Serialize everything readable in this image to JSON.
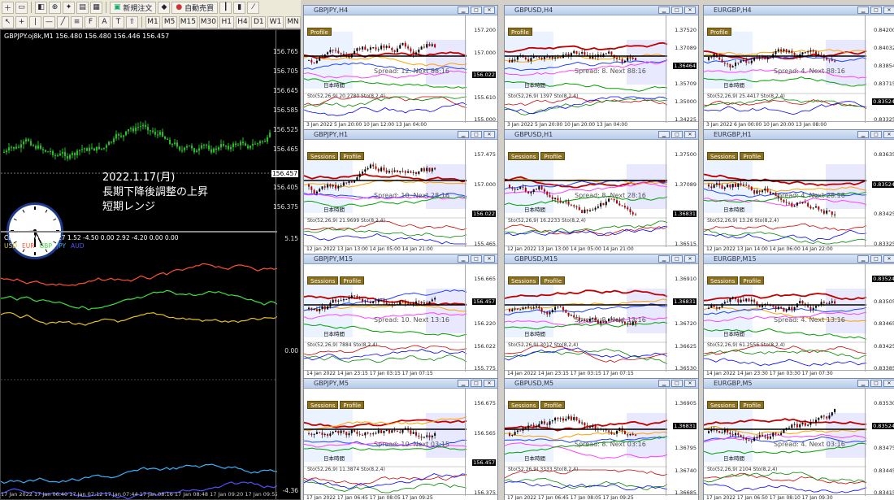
{
  "toolbar": {
    "new_order": "新規注文",
    "auto_trading": "自動売買",
    "timeframes": [
      "M1",
      "M5",
      "M15",
      "M30",
      "H1",
      "H4",
      "D1",
      "W1",
      "MN"
    ]
  },
  "main_chart": {
    "title": "GBPJPY.oj8k,M1  156.480 156.480 156.446 156.457",
    "price_ticks": [
      "156.765",
      "156.705",
      "156.645",
      "156.585",
      "156.525",
      "156.465",
      "156.457",
      "156.405",
      "156.375"
    ],
    "current_price": "156.457",
    "annotation_lines": [
      "2022.1.17(月)",
      "長期下降後調整の上昇",
      "短期レンジ"
    ],
    "indicator_title": "CurrencyPower 4.27 1.52 -4.50 0.00 2.92 -4.20 0.00 0.00",
    "legend": [
      "USD",
      "EUR",
      "GBP",
      "JPY",
      "AUD"
    ],
    "indicator_ticks": [
      "5.15",
      "0.00",
      "-4.36"
    ],
    "time_axis": "17 Jan 2022  17 Jan 06:40  17 Jan 07:12  17 Jan 07:44  17 Jan 08:16  17 Jan 08:48  17 Jan 09:20  17 Jan 09:52  17 Jan 10:24"
  },
  "colors": {
    "usd": "#e8c020",
    "eur": "#ff5030",
    "gbp": "#40e040",
    "jpy": "#3ab0ff",
    "aud": "#5050ff"
  },
  "charts": [
    {
      "title": "GBPJPY,H4",
      "tags": [
        "Profile"
      ],
      "ticks": [
        "157.200",
        "157.000",
        "156.022",
        "155.610",
        "155.000"
      ],
      "hl": "156.022",
      "spread": "Spread: 12.  Next 88:16",
      "xaxis": "3 Jan 2022   5 Jan 20:00   10 Jan 12:00   13 Jan 04:00",
      "osc": "Sto(52,26,9) 20.2780  Sto(8,2,4)"
    },
    {
      "title": "GBPUSD,H4",
      "tags": [
        "Profile"
      ],
      "ticks": [
        "1.37520",
        "1.37089",
        "1.36464",
        "1.35709",
        "1.35000",
        "1.34225"
      ],
      "hl": "1.36464",
      "spread": "Spread: 8.  Next 88:16",
      "xaxis": "3 Jan 2022   5 Jan 20:00   10 Jan 20:00   13 Jan 04:00",
      "osc": "Sto(52,26,9) 1397  Sto(8,2,4)"
    },
    {
      "title": "EURGBP,H4",
      "tags": [
        "Profile"
      ],
      "ticks": [
        "0.84200",
        "0.84032",
        "0.83854",
        "0.83715",
        "0.83524",
        "0.83325"
      ],
      "hl": "0.83524",
      "spread": "Spread: 4.  Next 88:16",
      "xaxis": "3 Jan 2022   6 Jan 00:00   10 Jan 20:00   13 Jan 08:00",
      "osc": "Sto(52,26,9) 25.4417  Sto(8,2,4)"
    },
    {
      "title": "GBPJPY,H1",
      "tags": [
        "Sessions",
        "Profile"
      ],
      "ticks": [
        "157.475",
        "157.000",
        "156.022",
        "155.465"
      ],
      "hl": "156.022",
      "spread": "Spread: 10.  Next 28:16",
      "xaxis": "12 Jan 2022   13 Jan 13:00   14 Jan 05:00   14 Jan 21:00",
      "osc": "Sto(52,26,9) 21.9699  Sto(8,2,4)"
    },
    {
      "title": "GBPUSD,H1",
      "tags": [
        "Sessions",
        "Profile"
      ],
      "ticks": [
        "1.37500",
        "1.37089",
        "1.36831",
        "1.36515"
      ],
      "hl": "1.36831",
      "spread": "Spread: 8.  Next 28:16",
      "xaxis": "12 Jan 2022   13 Jan 13:00   14 Jan 05:00   14 Jan 21:00",
      "osc": "Sto(52,26,9) 16.2233  Sto(8,2,4)"
    },
    {
      "title": "EURGBP,H1",
      "tags": [
        "Sessions",
        "Profile"
      ],
      "ticks": [
        "0.83635",
        "0.83524",
        "0.83425",
        "0.83325"
      ],
      "hl": "0.83524",
      "spread": "Spread: 4.  Next 28:16",
      "xaxis": "12 Jan 2022   13 Jan 14:00   14 Jan 06:00   14 Jan 22:00",
      "osc": "Sto(52,26,9) 13.26  Sto(8,2,4)"
    },
    {
      "title": "GBPJPY,M15",
      "tags": [
        "Sessions",
        "Profile"
      ],
      "ticks": [
        "156.665",
        "156.457",
        "156.220",
        "156.022",
        "155.775"
      ],
      "hl": "156.457",
      "spread": "Spread: 10.  Next 13:16",
      "xaxis": "14 Jan 2022   14 Jan 23:15   17 Jan 03:15   17 Jan 07:15",
      "osc": "Sto(52,26,9) 7884  Sto(8,2,4)"
    },
    {
      "title": "GBPUSD,M15",
      "tags": [
        "Sessions",
        "Profile"
      ],
      "ticks": [
        "1.36910",
        "1.36831",
        "1.36720",
        "1.36625",
        "1.36530"
      ],
      "hl": "1.36831",
      "spread": "Spread: 8.  Next 13:16",
      "xaxis": "14 Jan 2022   14 Jan 23:15   17 Jan 03:15   17 Jan 07:15",
      "osc": "Sto(52,26,9) 3017  Sto(8,2,4)"
    },
    {
      "title": "EURGBP,M15",
      "tags": [
        "Sessions",
        "Profile"
      ],
      "ticks": [
        "0.83524",
        "0.83505",
        "0.83465",
        "0.83425",
        "0.83385"
      ],
      "hl": "0.83524",
      "spread": "Spread: 4.  Next 13:16",
      "xaxis": "14 Jan 2022   14 Jan 23:30   17 Jan 03:30   17 Jan 07:30",
      "osc": "Sto(52,26,9) 61.2556  Sto(8,2,4)"
    },
    {
      "title": "GBPJPY,M5",
      "tags": [
        "Sessions",
        "Profile"
      ],
      "ticks": [
        "156.675",
        "156.565",
        "156.457",
        "156.375"
      ],
      "hl": "156.457",
      "spread": "Spread: 10.  Next 03:15",
      "xaxis": "17 Jan 2022   17 Jan 06:45   17 Jan 08:05   17 Jan 09:25",
      "osc": "Sto(52,26,9) 11.3874  Sto(8,2,4)"
    },
    {
      "title": "GBPUSD,M5",
      "tags": [
        "Sessions",
        "Profile"
      ],
      "ticks": [
        "1.36905",
        "1.36831",
        "1.36795",
        "1.36740",
        "1.36685"
      ],
      "hl": "1.36831",
      "spread": "Spread: 8.  Next 03:16",
      "xaxis": "17 Jan 2022   17 Jan 06:45   17 Jan 08:05   17 Jan 09:25",
      "osc": "Sto(52,26,9) 3333  Sto(8,2,4)"
    },
    {
      "title": "EURGBP,M5",
      "tags": [
        "Sessions",
        "Profile"
      ],
      "ticks": [
        "0.83530",
        "0.83524",
        "0.83475",
        "0.83445",
        "0.83415"
      ],
      "hl": "0.83524",
      "spread": "Spread: 4.  Next 03:16",
      "xaxis": "17 Jan 2022   17 Jan 06:50   17 Jan 08:10   17 Jan 09:30",
      "osc": "Sto(52,26,9) 2104  Sto(8,2,4)"
    }
  ]
}
